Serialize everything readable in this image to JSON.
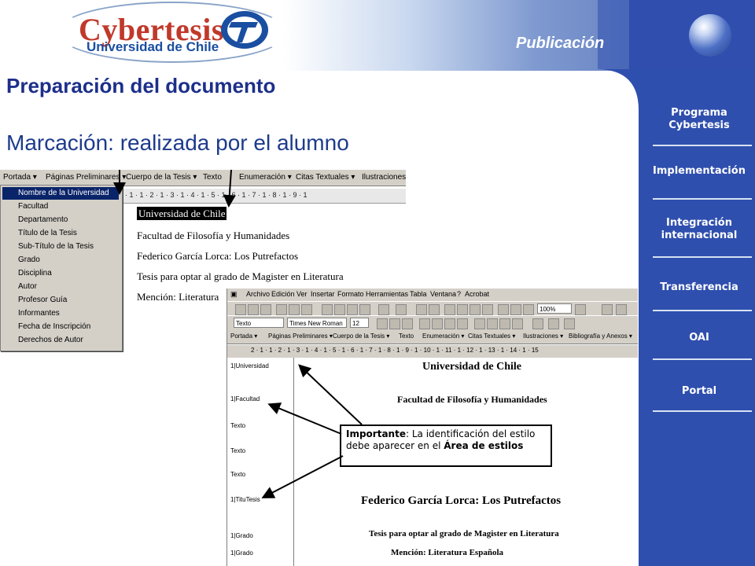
{
  "header": {
    "logo_title": "Cybertesis",
    "logo_subtitle": "Universidad de Chile",
    "section_label": "Publicación"
  },
  "nav": {
    "items": [
      {
        "label_line1": "Programa",
        "label_line2": "Cybertesis"
      },
      {
        "label_line1": "Implementación",
        "label_line2": ""
      },
      {
        "label_line1": "Integración",
        "label_line2": "internacional"
      },
      {
        "label_line1": "Transferencia",
        "label_line2": ""
      },
      {
        "label_line1": "OAI",
        "label_line2": ""
      },
      {
        "label_line1": "Portal",
        "label_line2": ""
      }
    ]
  },
  "main": {
    "title": "Preparación del documento",
    "subtitle": "Marcación: realizada por el alumno"
  },
  "word1": {
    "menu": [
      "Portada ▾",
      "Páginas Preliminares ▾",
      "Cuerpo de la Tesis ▾",
      "Texto",
      "Enumeración ▾",
      "Citas Textuales ▾",
      "Ilustraciones"
    ],
    "ruler": "· 1 · 1 · 2 · 1 · 3 · 1 · 4 · 1 · 5 · 1 · 6 · 1 · 7 · 1 · 8 · 1 · 9 · 1",
    "lines": [
      "Universidad de Chile",
      "Facultad de Filosofía y Humanidades",
      "Federico García Lorca: Los Putrefactos",
      "Tesis para optar al grado de  Magister en Literatura",
      "Mención: Literatura"
    ],
    "dropdown": [
      "Nombre de la Universidad",
      "Facultad",
      "Departamento",
      "Título de la Tesis",
      "Sub-Título de la Tesis",
      "Grado",
      "Disciplina",
      "Autor",
      "Profesor Guía",
      "Informantes",
      "Fecha de Inscripción",
      "Derechos de Autor"
    ]
  },
  "word2": {
    "menu": [
      "Archivo",
      "Edición",
      "Ver",
      "Insertar",
      "Formato",
      "Herramientas",
      "Tabla",
      "Ventana",
      "?",
      "Acrobat"
    ],
    "zoom": "100%",
    "style_select": "Texto",
    "font_select": "Times New Roman",
    "size_select": "12",
    "bar3": [
      "Portada ▾",
      "Páginas Preliminares ▾",
      "Cuerpo de la Tesis ▾",
      "Texto",
      "Enumeración ▾",
      "Citas Textuales ▾",
      "Ilustraciones ▾",
      "Bibliografía y Anexos ▾"
    ],
    "ruler": "2 · 1 · 1 · 2 · 1 · 3 · 1 · 4 · 1 · 5 · 1 · 6 · 1 · 7 · 1 · 8 · 1 · 9 · 1 · 10 · 1 · 11 · 1 · 12 · 1 · 13 · 1 · 14 · 1 · 15",
    "style_area": [
      "1|Universidad",
      "1|Facultad",
      "Texto",
      "Texto",
      "Texto",
      "1|TituTesis",
      "1|Grado",
      "1|Grado"
    ],
    "doc": [
      "Universidad de Chile",
      "Facultad de Filosofía y Humanidades",
      "Federico García Lorca: Los Putrefactos",
      "Tesis para optar al grado de  Magister en Literatura",
      "Mención: Literatura Española"
    ]
  },
  "callout": {
    "bold1": "Importante",
    "text1": ":  La identificación del estilo debe aparecer en el ",
    "bold2": "Área de estilos"
  },
  "colors": {
    "panel_blue": "#2f4fae",
    "title_blue": "#1d2f8a",
    "logo_red": "#c0392b"
  }
}
